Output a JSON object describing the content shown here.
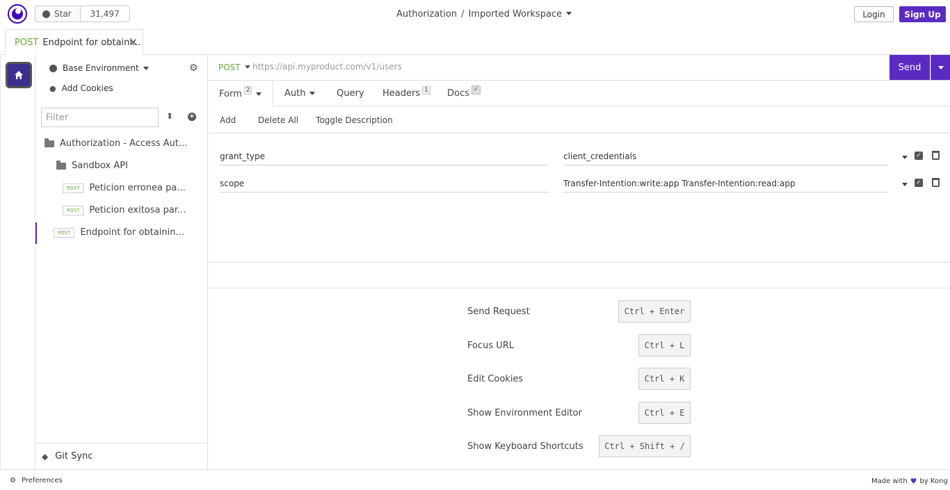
{
  "github": {
    "star_label": "Star",
    "count": "31,497"
  },
  "breadcrumb": {
    "project": "Authorization",
    "separator": "/",
    "workspace": "Imported Workspace"
  },
  "auth": {
    "login": "Login",
    "signup": "Sign Up"
  },
  "open_tab": {
    "method": "POST",
    "title": "Endpoint for obtaini...",
    "close": "✕"
  },
  "sidebar": {
    "environment": "Base Environment",
    "cookies": "Add Cookies",
    "filter_placeholder": "Filter",
    "tree": [
      {
        "label": "Authorization - Access Aut...",
        "type": "folder"
      },
      {
        "label": "Sandbox API",
        "type": "folder"
      },
      {
        "label": "Peticion erronea pa...",
        "method": "POST"
      },
      {
        "label": "Peticion exitosa par...",
        "method": "POST"
      },
      {
        "label": "Endpoint for obtainin...",
        "method": "POST"
      }
    ],
    "git_sync": "Git Sync"
  },
  "request": {
    "method": "POST",
    "url_placeholder": "https://api.myproduct.com/v1/users",
    "send": "Send"
  },
  "tabs": {
    "form": "Form",
    "form_count": "2",
    "auth": "Auth",
    "query": "Query",
    "headers": "Headers",
    "headers_count": "1",
    "docs": "Docs"
  },
  "actions": {
    "add": "Add",
    "delete_all": "Delete All",
    "toggle_description": "Toggle Description"
  },
  "params": [
    {
      "key": "grant_type",
      "value": "client_credentials"
    },
    {
      "key": "scope",
      "value": "Transfer-Intention:write:app Transfer-Intention:read:app"
    }
  ],
  "shortcuts": [
    {
      "label": "Send Request",
      "keys": "Ctrl + Enter"
    },
    {
      "label": "Focus URL",
      "keys": "Ctrl + L"
    },
    {
      "label": "Edit Cookies",
      "keys": "Ctrl + K"
    },
    {
      "label": "Show Environment Editor",
      "keys": "Ctrl + E"
    },
    {
      "label": "Show Keyboard Shortcuts",
      "keys": "Ctrl + Shift + /"
    }
  ],
  "footer": {
    "preferences": "Preferences",
    "made_with": "Made with",
    "by": "by Kong"
  },
  "colors": {
    "accent": "#5a2bc2",
    "method_post": "#6aaa3a"
  }
}
